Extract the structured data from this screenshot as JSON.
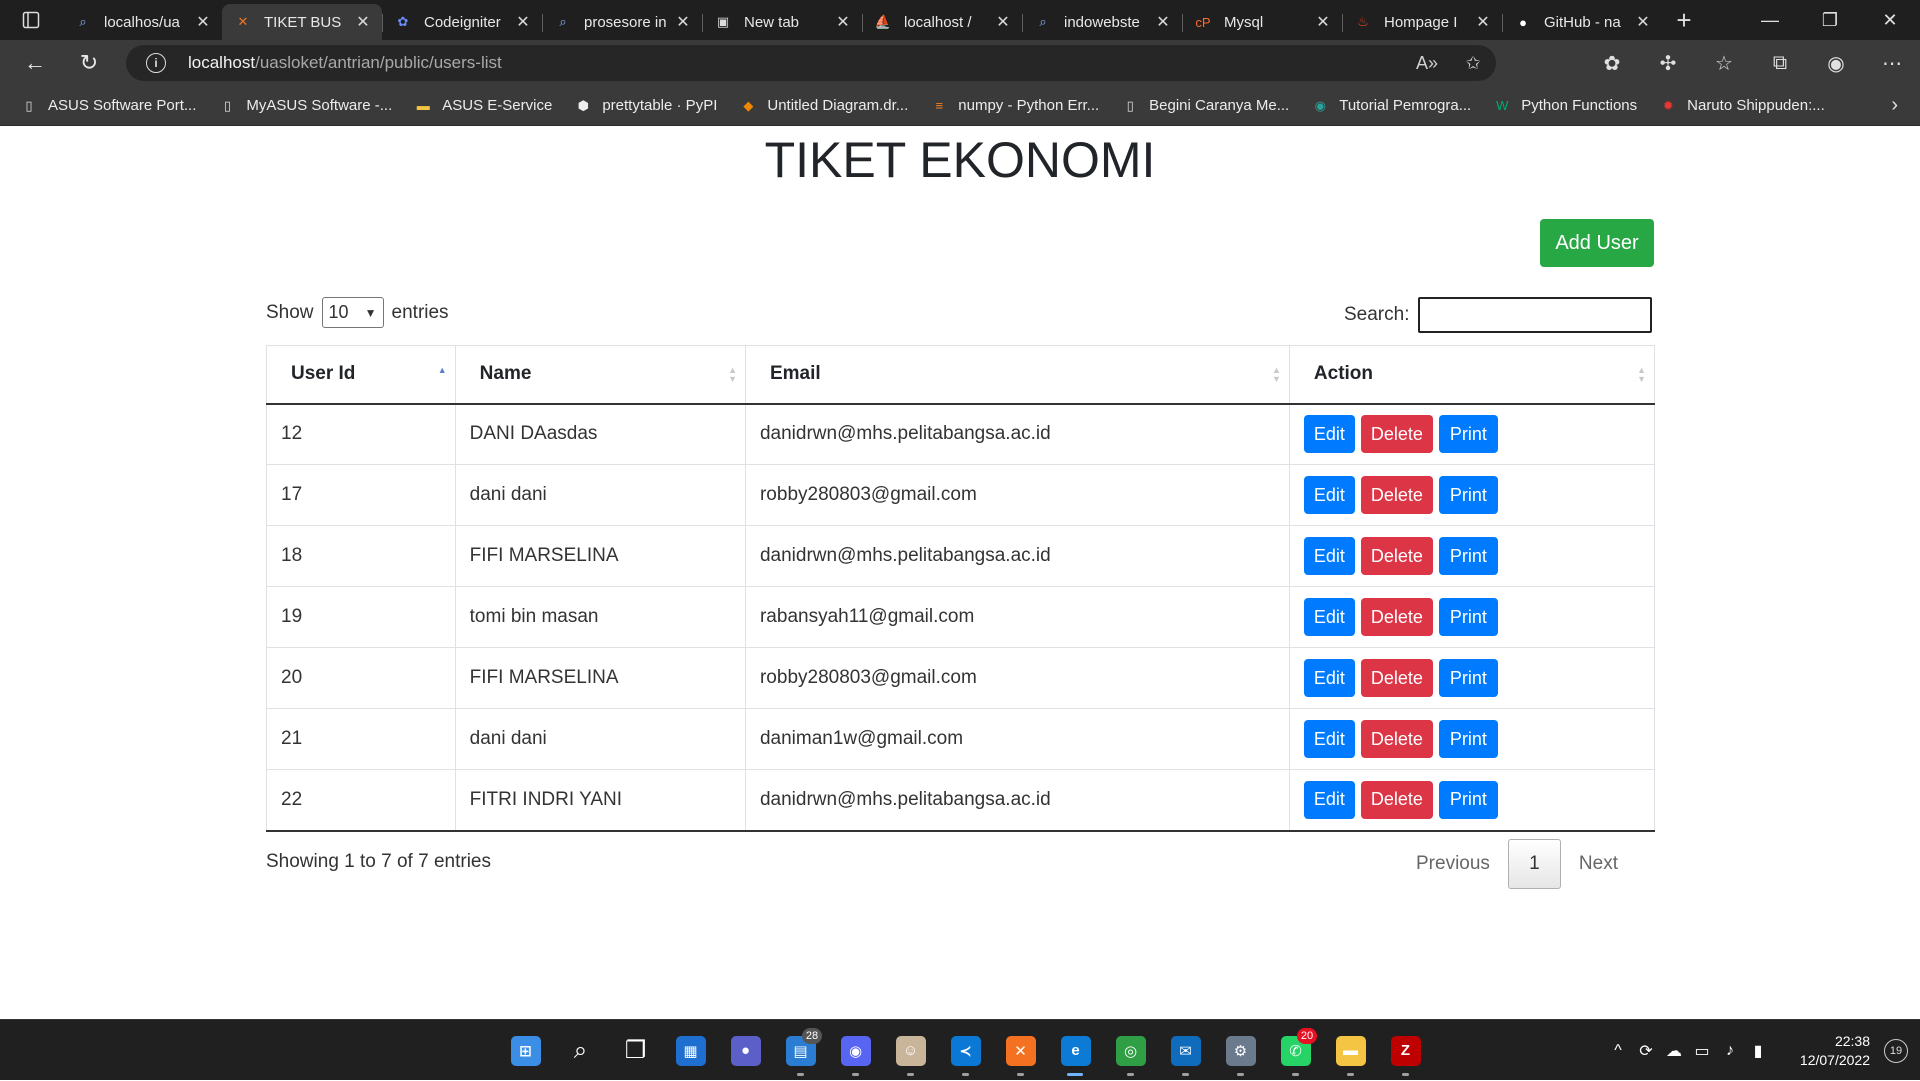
{
  "browser": {
    "tabs": [
      {
        "title": "localhos/ua",
        "icon": "search-icon",
        "active": false
      },
      {
        "title": "TIKET BUS",
        "icon": "xampp-icon",
        "active": true
      },
      {
        "title": "Codeigniter",
        "icon": "codeigniter-icon",
        "active": false
      },
      {
        "title": "prosesore in",
        "icon": "search-icon",
        "active": false
      },
      {
        "title": "New tab",
        "icon": "newtab-icon",
        "active": false
      },
      {
        "title": "localhost /",
        "icon": "phpmyadmin-icon",
        "active": false
      },
      {
        "title": "indowebste",
        "icon": "search-icon",
        "active": false
      },
      {
        "title": "Mysql",
        "icon": "cpanel-icon",
        "active": false
      },
      {
        "title": "Hompage I",
        "icon": "codeigniter-flame-icon",
        "active": false
      },
      {
        "title": "GitHub - na",
        "icon": "github-icon",
        "active": false
      }
    ],
    "url_host": "localhost",
    "url_path": "/uasloket/antrian/public/users-list",
    "bookmarks": [
      {
        "label": "ASUS Software Port...",
        "icon": "page-icon"
      },
      {
        "label": "MyASUS Software -...",
        "icon": "page-icon"
      },
      {
        "label": "ASUS E-Service",
        "icon": "folder-icon"
      },
      {
        "label": "prettytable · PyPI",
        "icon": "pypi-icon"
      },
      {
        "label": "Untitled Diagram.dr...",
        "icon": "drawio-icon"
      },
      {
        "label": "numpy - Python Err...",
        "icon": "stackoverflow-icon"
      },
      {
        "label": "Begini Caranya Me...",
        "icon": "page-icon"
      },
      {
        "label": "Tutorial Pemrogra...",
        "icon": "site-icon"
      },
      {
        "label": "Python Functions",
        "icon": "w3schools-icon"
      },
      {
        "label": "Naruto Shippuden:...",
        "icon": "naruto-icon"
      }
    ]
  },
  "page": {
    "title": "TIKET EKONOMI",
    "add_button": "Add User",
    "show_label": "Show",
    "entries_label": "entries",
    "page_length": "10",
    "search_label": "Search:",
    "search_value": "",
    "columns": [
      "User Id",
      "Name",
      "Email",
      "Action"
    ],
    "rows": [
      {
        "id": "12",
        "name": "DANI DAasdas",
        "email": "danidrwn@mhs.pelitabangsa.ac.id"
      },
      {
        "id": "17",
        "name": "dani dani",
        "email": "robby280803@gmail.com"
      },
      {
        "id": "18",
        "name": "FIFI MARSELINA",
        "email": "danidrwn@mhs.pelitabangsa.ac.id"
      },
      {
        "id": "19",
        "name": "tomi bin masan",
        "email": "rabansyah11@gmail.com"
      },
      {
        "id": "20",
        "name": "FIFI MARSELINA",
        "email": "robby280803@gmail.com"
      },
      {
        "id": "21",
        "name": "dani dani",
        "email": "daniman1w@gmail.com"
      },
      {
        "id": "22",
        "name": "FITRI INDRI YANI",
        "email": "danidrwn@mhs.pelitabangsa.ac.id"
      }
    ],
    "actions": {
      "edit": "Edit",
      "delete": "Delete",
      "print": "Print"
    },
    "info": "Showing 1 to 7 of 7 entries",
    "pagination": {
      "previous": "Previous",
      "current": "1",
      "next": "Next"
    },
    "colors": {
      "success": "#28a745",
      "primary": "#007bff",
      "danger": "#dc3545"
    }
  },
  "taskbar": {
    "apps": [
      {
        "name": "start-icon",
        "color": "#3a8ee6",
        "glyph": "⊞"
      },
      {
        "name": "search-icon",
        "color": "transparent",
        "glyph": "⌕"
      },
      {
        "name": "task-view-icon",
        "color": "transparent",
        "glyph": "❐"
      },
      {
        "name": "widgets-icon",
        "color": "#1f6fd1",
        "glyph": "▦"
      },
      {
        "name": "teams-chat-icon",
        "color": "#5b5fc7",
        "glyph": "●"
      },
      {
        "name": "store-icon",
        "color": "#2b7cd3",
        "glyph": "▤",
        "badge": "28"
      },
      {
        "name": "discord-icon",
        "color": "#5865f2",
        "glyph": "◉"
      },
      {
        "name": "photo-app-icon",
        "color": "#c9b59a",
        "glyph": "☺"
      },
      {
        "name": "vscode-icon",
        "color": "#0a78d4",
        "glyph": "≺"
      },
      {
        "name": "xampp-icon",
        "color": "#f37121",
        "glyph": "✕"
      },
      {
        "name": "edge-icon",
        "color": "#0c7bd6",
        "glyph": "e",
        "active": true
      },
      {
        "name": "chrome-icon",
        "color": "#2f9e44",
        "glyph": "◎"
      },
      {
        "name": "mail-icon",
        "color": "#0f6cbd",
        "glyph": "✉"
      },
      {
        "name": "settings-icon",
        "color": "#6b7a8c",
        "glyph": "⚙"
      },
      {
        "name": "whatsapp-icon",
        "color": "#25d366",
        "glyph": "✆",
        "badge": "20"
      },
      {
        "name": "file-explorer-icon",
        "color": "#f4c542",
        "glyph": "▬"
      },
      {
        "name": "filezilla-icon",
        "color": "#bf0000",
        "glyph": "Z"
      }
    ],
    "time": "22:38",
    "date": "12/07/2022",
    "notifications": "19"
  }
}
